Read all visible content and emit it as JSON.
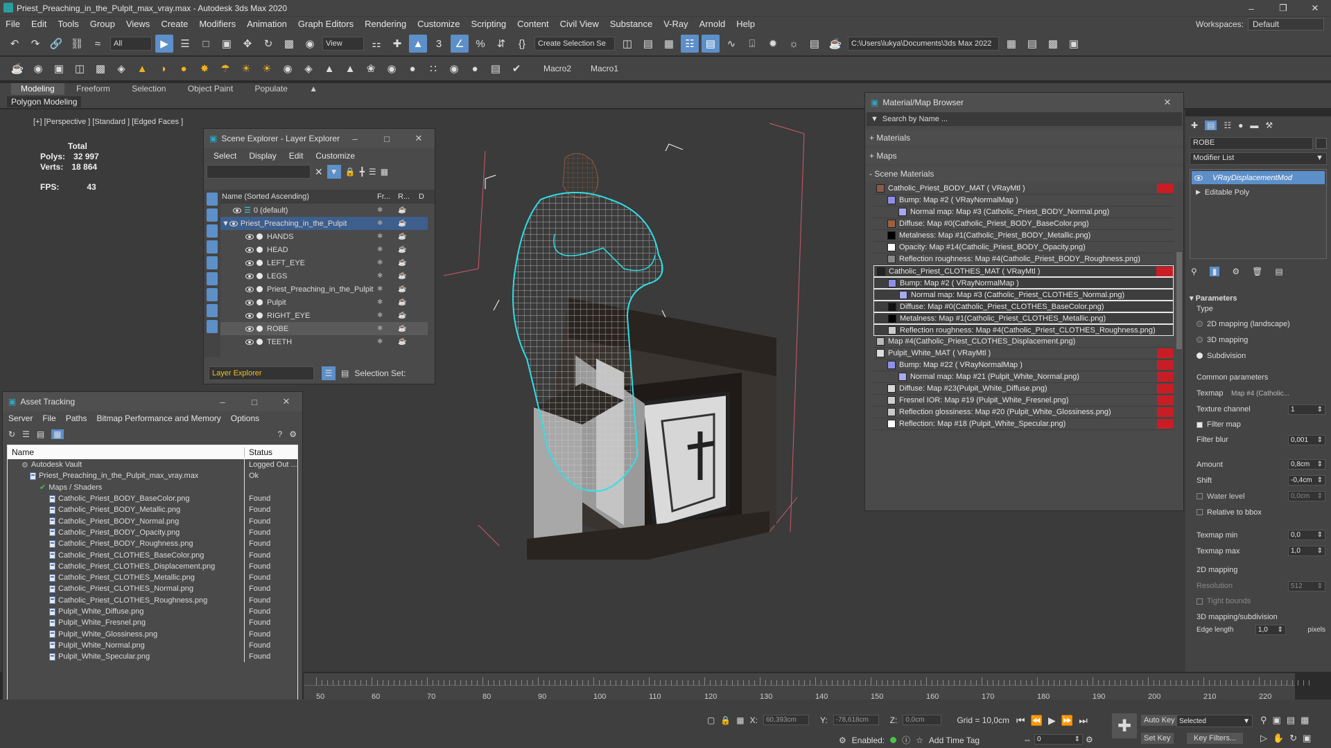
{
  "app": {
    "title": "Priest_Preaching_in_the_Pulpit_max_vray.max - Autodesk 3ds Max 2020"
  },
  "menu": [
    "File",
    "Edit",
    "Tools",
    "Group",
    "Views",
    "Create",
    "Modifiers",
    "Animation",
    "Graph Editors",
    "Rendering",
    "Customize",
    "Scripting",
    "Content",
    "Civil View",
    "Substance",
    "V-Ray",
    "Arnold",
    "Help"
  ],
  "workspace": {
    "label": "Workspaces:",
    "value": "Default"
  },
  "toolbar": {
    "filter": "All",
    "view": "View",
    "selset": "Create Selection Se",
    "path": "C:\\Users\\lukya\\Documents\\3ds Max 2022",
    "macro2": "Macro2",
    "macro1": "Macro1"
  },
  "ribbon": {
    "tabs": [
      "Modeling",
      "Freeform",
      "Selection",
      "Object Paint",
      "Populate"
    ],
    "sub": "Polygon Modeling"
  },
  "viewport": {
    "label": "[+] [Perspective ] [Standard ] [Edged Faces ]",
    "total": "Total",
    "polys_l": "Polys:",
    "polys_v": "32 997",
    "verts_l": "Verts:",
    "verts_v": "18 864",
    "fps_l": "FPS:",
    "fps_v": "43"
  },
  "scene_explorer": {
    "title": "Scene Explorer - Layer Explorer",
    "menu": [
      "Select",
      "Display",
      "Edit",
      "Customize"
    ],
    "col_name": "Name (Sorted Ascending)",
    "col_fr": "Fr...",
    "col_r": "R...",
    "col_d": "D",
    "rows": [
      {
        "name": "0 (default)",
        "level": 1
      },
      {
        "name": "Priest_Preaching_in_the_Pulpit",
        "level": 1
      },
      {
        "name": "HANDS",
        "level": 2
      },
      {
        "name": "HEAD",
        "level": 2
      },
      {
        "name": "LEFT_EYE",
        "level": 2
      },
      {
        "name": "LEGS",
        "level": 2
      },
      {
        "name": "Priest_Preaching_in_the_Pulpit",
        "level": 2
      },
      {
        "name": "Pulpit",
        "level": 2
      },
      {
        "name": "RIGHT_EYE",
        "level": 2
      },
      {
        "name": "ROBE",
        "level": 2
      },
      {
        "name": "TEETH",
        "level": 2
      }
    ],
    "footer_dd": "Layer Explorer",
    "footer_sel": "Selection Set:"
  },
  "asset_tracking": {
    "title": "Asset Tracking",
    "menu": [
      "Server",
      "File",
      "Paths",
      "Bitmap Performance and Memory",
      "Options"
    ],
    "col_name": "Name",
    "col_status": "Status",
    "rows": [
      {
        "name": "Autodesk Vault",
        "status": "Logged Out ...",
        "level": 1
      },
      {
        "name": "Priest_Preaching_in_the_Pulpit_max_vray.max",
        "status": "Ok",
        "level": 2
      },
      {
        "name": "Maps / Shaders",
        "status": "",
        "level": 3
      },
      {
        "name": "Catholic_Priest_BODY_BaseColor.png",
        "status": "Found",
        "level": 4
      },
      {
        "name": "Catholic_Priest_BODY_Metallic.png",
        "status": "Found",
        "level": 4
      },
      {
        "name": "Catholic_Priest_BODY_Normal.png",
        "status": "Found",
        "level": 4
      },
      {
        "name": "Catholic_Priest_BODY_Opacity.png",
        "status": "Found",
        "level": 4
      },
      {
        "name": "Catholic_Priest_BODY_Roughness.png",
        "status": "Found",
        "level": 4
      },
      {
        "name": "Catholic_Priest_CLOTHES_BaseColor.png",
        "status": "Found",
        "level": 4
      },
      {
        "name": "Catholic_Priest_CLOTHES_Displacement.png",
        "status": "Found",
        "level": 4
      },
      {
        "name": "Catholic_Priest_CLOTHES_Metallic.png",
        "status": "Found",
        "level": 4
      },
      {
        "name": "Catholic_Priest_CLOTHES_Normal.png",
        "status": "Found",
        "level": 4
      },
      {
        "name": "Catholic_Priest_CLOTHES_Roughness.png",
        "status": "Found",
        "level": 4
      },
      {
        "name": "Pulpit_White_Diffuse.png",
        "status": "Found",
        "level": 4
      },
      {
        "name": "Pulpit_White_Fresnel.png",
        "status": "Found",
        "level": 4
      },
      {
        "name": "Pulpit_White_Glossiness.png",
        "status": "Found",
        "level": 4
      },
      {
        "name": "Pulpit_White_Normal.png",
        "status": "Found",
        "level": 4
      },
      {
        "name": "Pulpit_White_Specular.png",
        "status": "Found",
        "level": 4
      }
    ]
  },
  "material_browser": {
    "title": "Material/Map Browser",
    "search": "Search by Name ...",
    "groups": [
      "+ Materials",
      "+ Maps",
      "- Scene Materials"
    ],
    "rows": [
      {
        "text": "Catholic_Priest_BODY_MAT  ( VRayMtl )",
        "indent": 0,
        "sw": "#8a5a4a",
        "red": true,
        "hl": false
      },
      {
        "text": "Bump: Map #2  ( VRayNormalMap )",
        "indent": 1,
        "sw": "#8f8fe8",
        "red": false,
        "hl": false
      },
      {
        "text": "Normal map: Map #3 (Catholic_Priest_BODY_Normal.png)",
        "indent": 2,
        "sw": "#a8a8f0",
        "red": false,
        "hl": false
      },
      {
        "text": "Diffuse: Map #0(Catholic_Priest_BODY_BaseColor.png)",
        "indent": 1,
        "sw": "#9a6040",
        "red": false,
        "hl": false
      },
      {
        "text": "Metalness: Map #1(Catholic_Priest_BODY_Metallic.png)",
        "indent": 1,
        "sw": "#000000",
        "red": false,
        "hl": false
      },
      {
        "text": "Opacity: Map #14(Catholic_Priest_BODY_Opacity.png)",
        "indent": 1,
        "sw": "#ffffff",
        "red": false,
        "hl": false
      },
      {
        "text": "Reflection roughness: Map #4(Catholic_Priest_BODY_Roughness.png)",
        "indent": 1,
        "sw": "#888888",
        "red": false,
        "hl": false
      },
      {
        "text": "Catholic_Priest_CLOTHES_MAT  ( VRayMtl )",
        "indent": 0,
        "sw": "#222222",
        "red": true,
        "hl": true
      },
      {
        "text": "Bump: Map #2  ( VRayNormalMap )",
        "indent": 1,
        "sw": "#8f8fe8",
        "red": false,
        "hl": true
      },
      {
        "text": "Normal map: Map #3 (Catholic_Priest_CLOTHES_Normal.png)",
        "indent": 2,
        "sw": "#a8a8f0",
        "red": false,
        "hl": true
      },
      {
        "text": "Diffuse: Map #0(Catholic_Priest_CLOTHES_BaseColor.png)",
        "indent": 1,
        "sw": "#111111",
        "red": false,
        "hl": true
      },
      {
        "text": "Metalness: Map #1(Catholic_Priest_CLOTHES_Metallic.png)",
        "indent": 1,
        "sw": "#000000",
        "red": false,
        "hl": true
      },
      {
        "text": "Reflection roughness: Map #4(Catholic_Priest_CLOTHES_Roughness.png)",
        "indent": 1,
        "sw": "#cccccc",
        "red": false,
        "hl": true
      },
      {
        "text": "Map #4(Catholic_Priest_CLOTHES_Displacement.png)",
        "indent": 0,
        "sw": "#bbbbbb",
        "red": false,
        "hl": false
      },
      {
        "text": "Pulpit_White_MAT  ( VRayMtl )",
        "indent": 0,
        "sw": "#dddddd",
        "red": true,
        "hl": false
      },
      {
        "text": "Bump: Map #22  ( VRayNormalMap )",
        "indent": 1,
        "sw": "#8f8fe8",
        "red": true,
        "hl": false
      },
      {
        "text": "Normal map: Map #21 (Pulpit_White_Normal.png)",
        "indent": 2,
        "sw": "#a8a8f0",
        "red": true,
        "hl": false
      },
      {
        "text": "Diffuse: Map #23(Pulpit_White_Diffuse.png)",
        "indent": 1,
        "sw": "#d9d9d9",
        "red": true,
        "hl": false
      },
      {
        "text": "Fresnel IOR: Map #19 (Pulpit_White_Fresnel.png)",
        "indent": 1,
        "sw": "#cfcfcf",
        "red": true,
        "hl": false
      },
      {
        "text": "Reflection glossiness: Map #20 (Pulpit_White_Glossiness.png)",
        "indent": 1,
        "sw": "#c8c8c8",
        "red": true,
        "hl": false
      },
      {
        "text": "Reflection: Map #18 (Pulpit_White_Specular.png)",
        "indent": 1,
        "sw": "#ffffff",
        "red": true,
        "hl": false
      }
    ]
  },
  "modify": {
    "object_name": "ROBE",
    "modlist": "Modifier List",
    "stack": [
      "VRayDisplacementMod",
      "Editable Poly"
    ],
    "params_title": "Parameters",
    "type_label": "Type",
    "types": [
      "2D mapping (landscape)",
      "3D mapping",
      "Subdivision"
    ],
    "common": "Common parameters",
    "texmap_l": "Texmap",
    "texmap_v": "Map #4 (Catholic...",
    "texchan_l": "Texture channel",
    "texchan_v": "1",
    "filtermap": "Filter map",
    "filterblur_l": "Filter blur",
    "filterblur_v": "0,001",
    "amount_l": "Amount",
    "amount_v": "0,8cm",
    "shift_l": "Shift",
    "shift_v": "-0,4cm",
    "water_l": "Water level",
    "water_v": "0,0cm",
    "relbbox": "Relative to bbox",
    "tmin_l": "Texmap min",
    "tmin_v": "0,0",
    "tmax_l": "Texmap max",
    "tmax_v": "1,0",
    "map2d": "2D mapping",
    "res_l": "Resolution",
    "res_v": "512",
    "tight": "Tight bounds",
    "map3d": "3D mapping/subdivision",
    "edge_l": "Edge length",
    "edge_v": "1,0",
    "edge_u": "pixels"
  },
  "timeline": {
    "ticks": [
      "50",
      "60",
      "70",
      "80",
      "90",
      "100",
      "110",
      "120",
      "130",
      "140",
      "150",
      "160",
      "170",
      "180",
      "190",
      "200",
      "210",
      "220"
    ]
  },
  "status": {
    "x_l": "X:",
    "x_v": "60,393cm",
    "y_l": "Y:",
    "y_v": "-78,618cm",
    "z_l": "Z:",
    "z_v": "0,0cm",
    "grid": "Grid = 10,0cm",
    "enabled": "Enabled:",
    "addtime": "Add Time Tag",
    "autokey": "Auto Key",
    "setkey": "Set Key",
    "selected": "Selected",
    "keyfilters": "Key Filters...",
    "frame": "0"
  }
}
